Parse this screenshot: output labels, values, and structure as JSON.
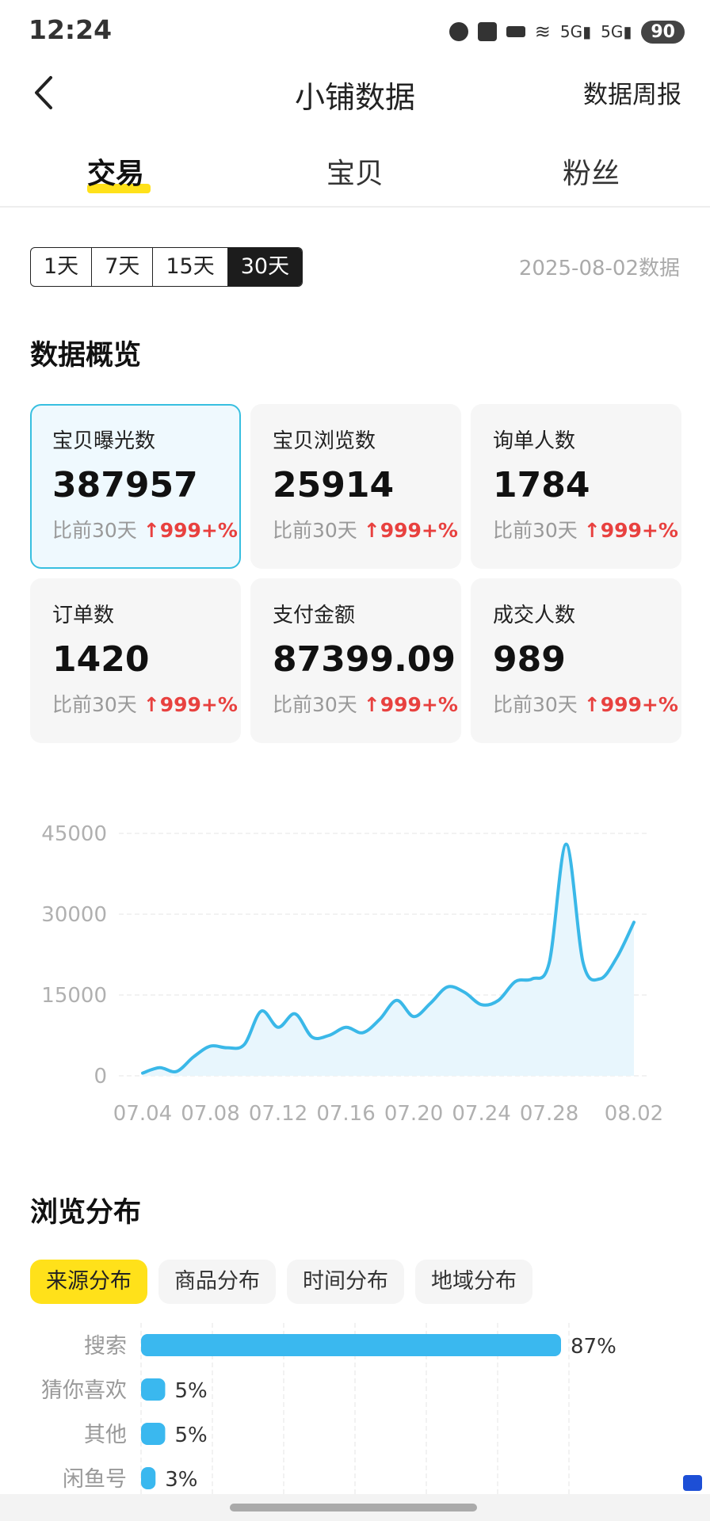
{
  "status": {
    "time": "12:24",
    "battery": "90"
  },
  "header": {
    "title": "小铺数据",
    "weekly_report": "数据周报"
  },
  "tabs": [
    {
      "label": "交易"
    },
    {
      "label": "宝贝"
    },
    {
      "label": "粉丝"
    }
  ],
  "range": {
    "options": [
      "1天",
      "7天",
      "15天",
      "30天"
    ],
    "selected": "30天",
    "date_note": "2025-08-02数据"
  },
  "overview": {
    "title": "数据概览",
    "cards": [
      {
        "label": "宝贝曝光数",
        "value": "387957",
        "compare": "比前30天",
        "change": "999+%"
      },
      {
        "label": "宝贝浏览数",
        "value": "25914",
        "compare": "比前30天",
        "change": "999+%"
      },
      {
        "label": "询单人数",
        "value": "1784",
        "compare": "比前30天",
        "change": "999+%"
      },
      {
        "label": "订单数",
        "value": "1420",
        "compare": "比前30天",
        "change": "999+%"
      },
      {
        "label": "支付金额",
        "value": "87399.09",
        "compare": "比前30天",
        "change": "999+%"
      },
      {
        "label": "成交人数",
        "value": "989",
        "compare": "比前30天",
        "change": "999+%"
      }
    ]
  },
  "chart_data": {
    "type": "area",
    "x": [
      "07.04",
      "07.05",
      "07.06",
      "07.07",
      "07.08",
      "07.09",
      "07.10",
      "07.11",
      "07.12",
      "07.13",
      "07.14",
      "07.15",
      "07.16",
      "07.17",
      "07.18",
      "07.19",
      "07.20",
      "07.21",
      "07.22",
      "07.23",
      "07.24",
      "07.25",
      "07.26",
      "07.27",
      "07.28",
      "07.29",
      "07.30",
      "07.31",
      "08.01",
      "08.02"
    ],
    "y": [
      500,
      1500,
      800,
      3500,
      5500,
      5200,
      5800,
      12000,
      9000,
      11500,
      7200,
      7500,
      9000,
      8000,
      10500,
      14000,
      11000,
      13500,
      16500,
      15500,
      13200,
      14000,
      17500,
      18000,
      21000,
      43000,
      21000,
      18000,
      22000,
      28500
    ],
    "xticks": [
      "07.04",
      "07.08",
      "07.12",
      "07.16",
      "07.20",
      "07.24",
      "07.28",
      "08.02"
    ],
    "yticks": [
      "0",
      "15000",
      "30000",
      "45000"
    ],
    "ylim": [
      0,
      45000
    ],
    "color": "#3ab8e8",
    "fill": "#e8f6fd",
    "grid": true
  },
  "distribution": {
    "title": "浏览分布",
    "tabs": [
      "来源分布",
      "商品分布",
      "时间分布",
      "地域分布"
    ],
    "active_tab": "来源分布",
    "bars": [
      {
        "label": "搜索",
        "pct": 87,
        "pct_label": "87%"
      },
      {
        "label": "猜你喜欢",
        "pct": 5,
        "pct_label": "5%"
      },
      {
        "label": "其他",
        "pct": 5,
        "pct_label": "5%"
      },
      {
        "label": "闲鱼号",
        "pct": 3,
        "pct_label": "3%"
      }
    ],
    "bar_color": "#3ab8ef"
  }
}
